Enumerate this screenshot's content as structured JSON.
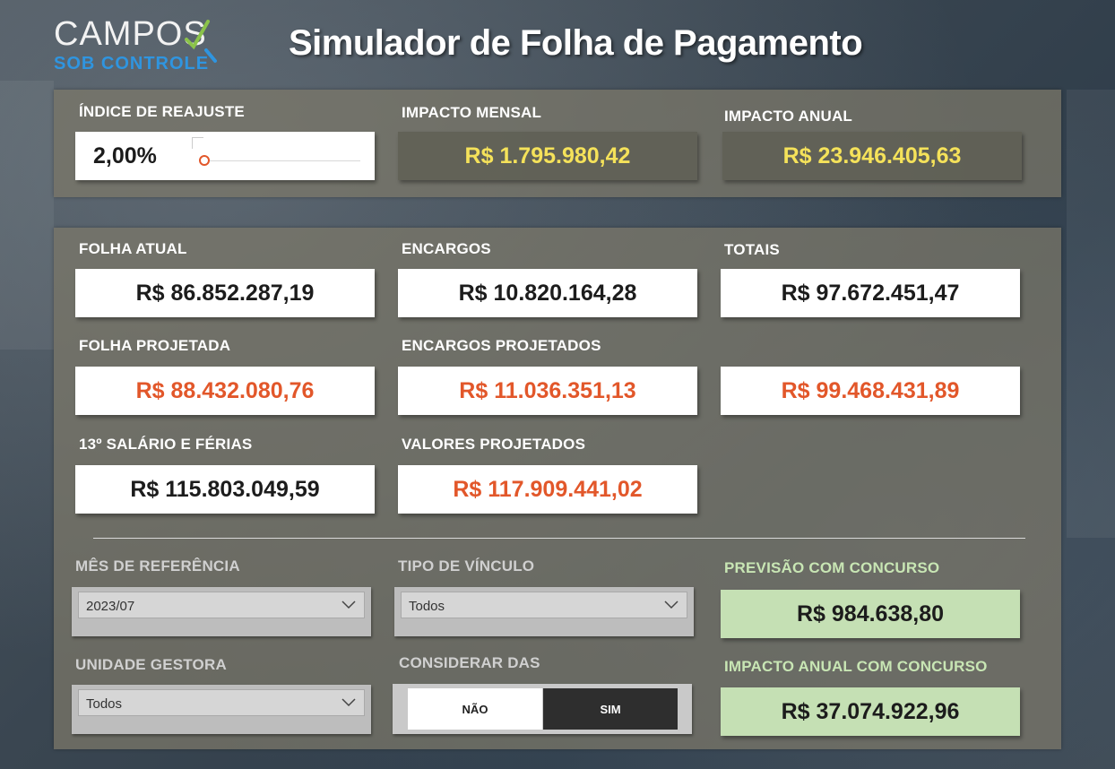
{
  "header": {
    "logo_top": "CAMPOS",
    "logo_bottom": "SOB CONTROLE",
    "title": "Simulador de Folha de Pagamento"
  },
  "top": {
    "indice_label": "ÍNDICE DE REAJUSTE",
    "indice_value": "2,00%",
    "impacto_mensal_label": "IMPACTO MENSAL",
    "impacto_mensal_value": "R$ 1.795.980,42",
    "impacto_anual_label": "IMPACTO ANUAL",
    "impacto_anual_value": "R$ 23.946.405,63"
  },
  "cards": {
    "folha_atual_label": "FOLHA ATUAL",
    "folha_atual_value": "R$ 86.852.287,19",
    "encargos_label": "ENCARGOS",
    "encargos_value": "R$ 10.820.164,28",
    "totais_label": "TOTAIS",
    "totais_value": "R$ 97.672.451,47",
    "folha_projetada_label": "FOLHA PROJETADA",
    "folha_projetada_value": "R$ 88.432.080,76",
    "encargos_projetados_label": "ENCARGOS PROJETADOS",
    "encargos_projetados_value": "R$ 11.036.351,13",
    "totais_projetados_value": "R$ 99.468.431,89",
    "salario_ferias_label": "13º SALÁRIO E FÉRIAS",
    "salario_ferias_value": "R$ 115.803.049,59",
    "valores_projetados_label": "VALORES PROJETADOS",
    "valores_projetados_value": "R$ 117.909.441,02"
  },
  "filters": {
    "mes_label": "MÊS DE REFERÊNCIA",
    "mes_value": "2023/07",
    "tipo_label": "TIPO DE VÍNCULO",
    "tipo_value": "Todos",
    "unidade_label": "UNIDADE GESTORA",
    "unidade_value": "Todos",
    "das_label": "CONSIDERAR DAS",
    "das_no": "NÃO",
    "das_yes": "SIM",
    "das_selected": "SIM"
  },
  "concurso": {
    "previsao_label": "PREVISÃO COM CONCURSO",
    "previsao_value": "R$ 984.638,80",
    "impacto_label": "IMPACTO ANUAL COM CONCURSO",
    "impacto_value": "R$ 37.074.922,96"
  },
  "colors": {
    "accent_orange": "#e2572a",
    "highlight_yellow": "#f5e25a",
    "mint": "#c5e0b4",
    "logo_blue": "#2f95e0"
  }
}
